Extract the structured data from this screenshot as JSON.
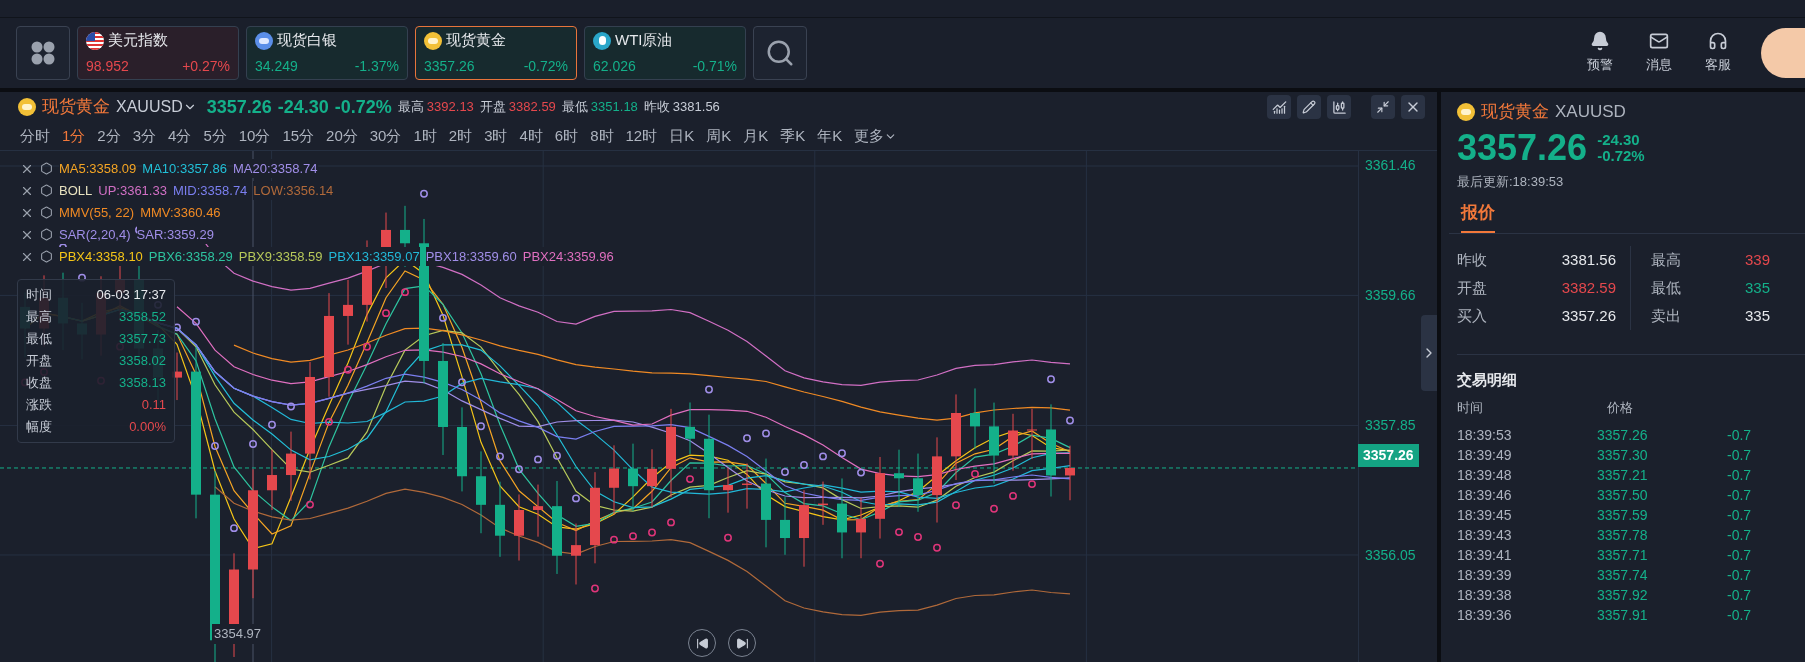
{
  "tickers": [
    {
      "name": "美元指数",
      "value": "98.952",
      "change": "+0.27%",
      "color": "#e5484d",
      "selected": false
    },
    {
      "name": "现货白银",
      "value": "34.249",
      "change": "-1.37%",
      "color": "#14b08a",
      "selected": false
    },
    {
      "name": "现货黄金",
      "value": "3357.26",
      "change": "-0.72%",
      "color": "#14b08a",
      "selected": true
    },
    {
      "name": "WTI原油",
      "value": "62.026",
      "change": "-0.71%",
      "color": "#14b08a",
      "selected": false
    }
  ],
  "top_actions": [
    {
      "label": "预警"
    },
    {
      "label": "消息"
    },
    {
      "label": "客服"
    }
  ],
  "chart_header": {
    "name": "现货黄金",
    "symbol": "XAUUSD",
    "price": "3357.26",
    "change": "-24.30",
    "change_pct": "-0.72%",
    "stats": [
      {
        "label": "最高",
        "value": "3392.13",
        "color": "#e5484d"
      },
      {
        "label": "开盘",
        "value": "3382.59",
        "color": "#e5484d"
      },
      {
        "label": "最低",
        "value": "3351.18",
        "color": "#14b08a"
      },
      {
        "label": "昨收",
        "value": "3381.56",
        "color": "#c7ccd6"
      }
    ]
  },
  "timeframes": [
    {
      "label": "分时",
      "selected": false
    },
    {
      "label": "1分",
      "selected": true
    },
    {
      "label": "2分",
      "selected": false
    },
    {
      "label": "3分",
      "selected": false
    },
    {
      "label": "4分",
      "selected": false
    },
    {
      "label": "5分",
      "selected": false
    },
    {
      "label": "10分",
      "selected": false
    },
    {
      "label": "15分",
      "selected": false
    },
    {
      "label": "20分",
      "selected": false
    },
    {
      "label": "30分",
      "selected": false
    },
    {
      "label": "1时",
      "selected": false
    },
    {
      "label": "2时",
      "selected": false
    },
    {
      "label": "3时",
      "selected": false
    },
    {
      "label": "4时",
      "selected": false
    },
    {
      "label": "6时",
      "selected": false
    },
    {
      "label": "8时",
      "selected": false
    },
    {
      "label": "12时",
      "selected": false
    },
    {
      "label": "日K",
      "selected": false
    },
    {
      "label": "周K",
      "selected": false
    },
    {
      "label": "月K",
      "selected": false
    },
    {
      "label": "季K",
      "selected": false
    },
    {
      "label": "年K",
      "selected": false
    }
  ],
  "more_label": "更多",
  "indicators": [
    {
      "entries": [
        {
          "text": "MA5:3358.09",
          "color": "#f5a524"
        },
        {
          "text": "MA10:3357.86",
          "color": "#22c0d8"
        },
        {
          "text": "MA20:3358.74",
          "color": "#a08ee8"
        }
      ]
    },
    {
      "entries": [
        {
          "text": "BOLL",
          "color": "#e8e2c0"
        },
        {
          "text": "UP:3361.33",
          "color": "#d16fc4"
        },
        {
          "text": "MID:3358.74",
          "color": "#7b7ff0"
        },
        {
          "text": "LOW:3356.14",
          "color": "#b0693a"
        }
      ]
    },
    {
      "entries": [
        {
          "text": "MMV(55, 22)",
          "color": "#f08a24"
        },
        {
          "text": "MMV:3360.46",
          "color": "#f08a24"
        }
      ]
    },
    {
      "entries": [
        {
          "text": "SAR(2,20,4)",
          "color": "#a08ee8"
        },
        {
          "text": "SAR:3359.29",
          "color": "#a08ee8"
        }
      ]
    },
    {
      "entries": [
        {
          "text": "PBX4:3358.10",
          "color": "#f5c518"
        },
        {
          "text": "PBX6:3358.29",
          "color": "#2ec4a0"
        },
        {
          "text": "PBX9:3358.59",
          "color": "#b7c95a"
        },
        {
          "text": "PBX13:3359.07",
          "color": "#22b8d8"
        },
        {
          "text": "PBX18:3359.60",
          "color": "#a08ee8"
        },
        {
          "text": "PBX24:3359.96",
          "color": "#e06fc0"
        }
      ]
    }
  ],
  "tooltip": [
    {
      "label": "时间",
      "value": "06-03 17:37",
      "color": "#e6e8ec"
    },
    {
      "label": "最高",
      "value": "3358.52",
      "color": "#14b08a"
    },
    {
      "label": "最低",
      "value": "3357.73",
      "color": "#14b08a"
    },
    {
      "label": "开盘",
      "value": "3358.02",
      "color": "#14b08a"
    },
    {
      "label": "收盘",
      "value": "3358.13",
      "color": "#14b08a"
    },
    {
      "label": "涨跌",
      "value": "0.11",
      "color": "#e5484d"
    },
    {
      "label": "幅度",
      "value": "0.00%",
      "color": "#e5484d"
    }
  ],
  "price_axis": [
    "3361.46",
    "3359.66",
    "3357.85",
    "3356.05"
  ],
  "current_price": "3357.26",
  "low_marker": "3354.97",
  "quote_panel": {
    "name": "现货黄金",
    "symbol": "XAUUSD",
    "price": "3357.26",
    "change": "-24.30",
    "change_pct": "-0.72%",
    "updated": "最后更新:18:39:53",
    "tabs": [
      {
        "label": "报价",
        "selected": true
      }
    ],
    "stats": [
      {
        "label": "昨收",
        "value": "3381.56",
        "color": "#e6e8ec"
      },
      {
        "label": "最高",
        "value": "339",
        "color": "#e5484d"
      },
      {
        "label": "开盘",
        "value": "3382.59",
        "color": "#e5484d"
      },
      {
        "label": "最低",
        "value": "335",
        "color": "#14b08a"
      },
      {
        "label": "买入",
        "value": "3357.26",
        "color": "#e6e8ec"
      },
      {
        "label": "卖出",
        "value": "335",
        "color": "#e6e8ec"
      }
    ],
    "trades_title": "交易明细",
    "trade_columns": [
      "时间",
      "价格"
    ],
    "trades": [
      {
        "time": "18:39:53",
        "price": "3357.26",
        "change": "-0.7"
      },
      {
        "time": "18:39:49",
        "price": "3357.30",
        "change": "-0.7"
      },
      {
        "time": "18:39:48",
        "price": "3357.21",
        "change": "-0.7"
      },
      {
        "time": "18:39:46",
        "price": "3357.50",
        "change": "-0.7"
      },
      {
        "time": "18:39:45",
        "price": "3357.59",
        "change": "-0.7"
      },
      {
        "time": "18:39:43",
        "price": "3357.78",
        "change": "-0.7"
      },
      {
        "time": "18:39:41",
        "price": "3357.71",
        "change": "-0.7"
      },
      {
        "time": "18:39:39",
        "price": "3357.74",
        "change": "-0.7"
      },
      {
        "time": "18:39:38",
        "price": "3357.92",
        "change": "-0.7"
      },
      {
        "time": "18:39:36",
        "price": "3357.91",
        "change": "-0.7"
      }
    ]
  }
}
